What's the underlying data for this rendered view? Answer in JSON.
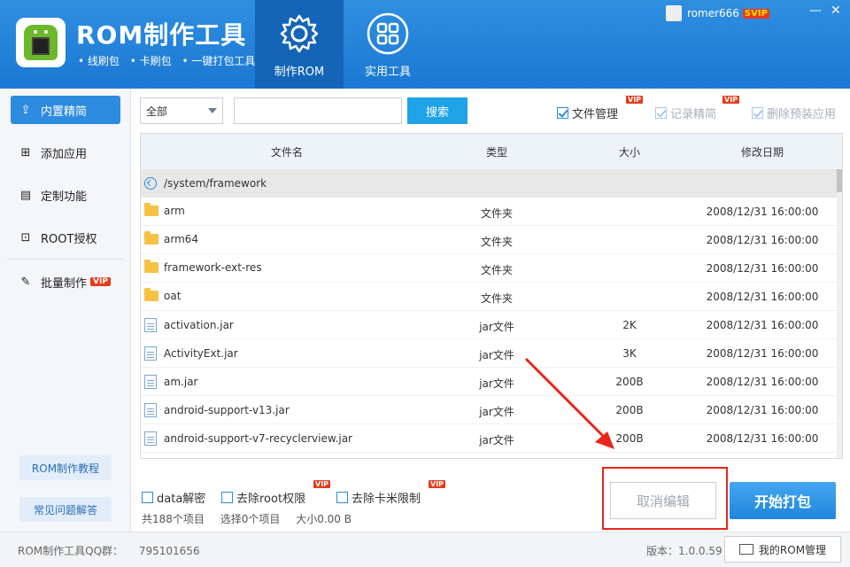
{
  "app": {
    "title": "ROM制作工具",
    "subtitle_items": [
      "• 线刷包",
      "• 卡刷包",
      "• 一键打包工具"
    ],
    "user_name": "romer666",
    "user_badge": "SVIP"
  },
  "nav_tabs": [
    {
      "label": "制作ROM",
      "icon": "gear-icon",
      "active": true
    },
    {
      "label": "实用工具",
      "icon": "grid-icon",
      "active": false
    }
  ],
  "sidebar": {
    "items": [
      {
        "label": "内置精简",
        "icon": "export-icon",
        "active": true
      },
      {
        "label": "添加应用",
        "icon": "plus-box-icon",
        "active": false
      },
      {
        "label": "定制功能",
        "icon": "doc-edit-icon",
        "active": false
      },
      {
        "label": "ROOT授权",
        "icon": "lock-icon",
        "active": false
      },
      {
        "label": "批量制作",
        "icon": "edit-icon",
        "active": false,
        "badge": "VIP"
      }
    ],
    "tutorial_label": "ROM制作教程",
    "faq_label": "常见问题解答"
  },
  "toolbar": {
    "filter_value": "全部",
    "search_value": "",
    "search_label": "搜索",
    "checks": [
      {
        "label": "文件管理",
        "checked": true,
        "disabled": false,
        "badge": "VIP"
      },
      {
        "label": "记录精简",
        "checked": true,
        "disabled": true,
        "badge": "VIP"
      },
      {
        "label": "删除预装应用",
        "checked": true,
        "disabled": true
      }
    ]
  },
  "table": {
    "headers": {
      "name": "文件名",
      "type": "类型",
      "size": "大小",
      "date": "修改日期"
    },
    "path": "/system/framework",
    "rows": [
      {
        "name": "arm",
        "type": "文件夹",
        "size": "",
        "date": "2008/12/31 16:00:00",
        "icon": "folder-icon"
      },
      {
        "name": "arm64",
        "type": "文件夹",
        "size": "",
        "date": "2008/12/31 16:00:00",
        "icon": "folder-icon"
      },
      {
        "name": "framework-ext-res",
        "type": "文件夹",
        "size": "",
        "date": "2008/12/31 16:00:00",
        "icon": "folder-icon"
      },
      {
        "name": "oat",
        "type": "文件夹",
        "size": "",
        "date": "2008/12/31 16:00:00",
        "icon": "folder-icon"
      },
      {
        "name": "activation.jar",
        "type": "jar文件",
        "size": "2K",
        "date": "2008/12/31 16:00:00",
        "icon": "file-icon"
      },
      {
        "name": "ActivityExt.jar",
        "type": "jar文件",
        "size": "3K",
        "date": "2008/12/31 16:00:00",
        "icon": "file-icon"
      },
      {
        "name": "am.jar",
        "type": "jar文件",
        "size": "200B",
        "date": "2008/12/31 16:00:00",
        "icon": "file-icon"
      },
      {
        "name": "android-support-v13.jar",
        "type": "jar文件",
        "size": "200B",
        "date": "2008/12/31 16:00:00",
        "icon": "file-icon"
      },
      {
        "name": "android-support-v7-recyclerview.jar",
        "type": "jar文件",
        "size": "200B",
        "date": "2008/12/31 16:00:00",
        "icon": "file-icon"
      }
    ]
  },
  "options": [
    {
      "label": "data解密",
      "checked": false
    },
    {
      "label": "去除root权限",
      "checked": false,
      "badge": "VIP"
    },
    {
      "label": "去除卡米限制",
      "checked": false,
      "badge": "VIP"
    }
  ],
  "stats": {
    "total": "共188个项目",
    "selected": "选择0个项目",
    "size": "大小0.00 B"
  },
  "actions": {
    "cancel_label": "取消编辑",
    "start_label": "开始打包"
  },
  "statusbar": {
    "qq_label": "ROM制作工具QQ群：",
    "qq_number": "795101656",
    "version": "版本：1.0.0.59",
    "my_rom_label": "我的ROM管理"
  },
  "colors": {
    "header": "#1b78d3",
    "accent": "#2d8be0",
    "vip": "#e73a1a",
    "annotation": "#e8261c"
  }
}
